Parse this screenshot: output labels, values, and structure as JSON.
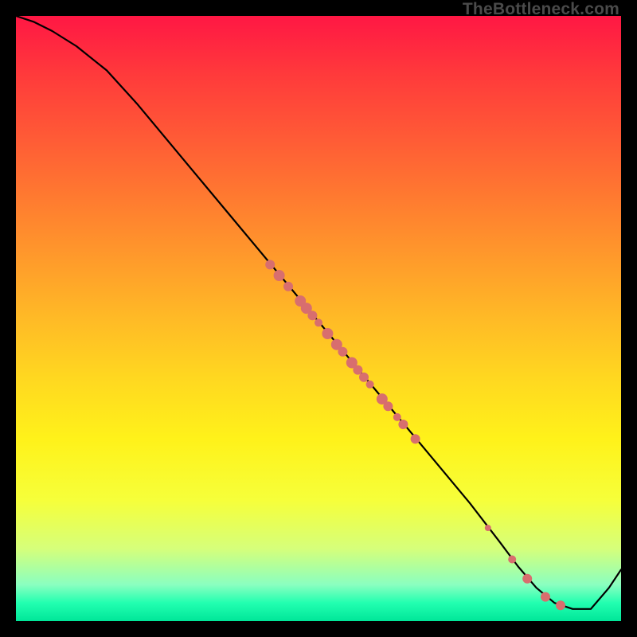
{
  "attribution": "TheBottleneck.com",
  "chart_data": {
    "type": "line",
    "title": "",
    "xlabel": "",
    "ylabel": "",
    "xlim": [
      0,
      100
    ],
    "ylim": [
      0,
      100
    ],
    "grid": false,
    "legend": false,
    "series": [
      {
        "name": "bottleneck-curve",
        "x": [
          0,
          3,
          6,
          10,
          15,
          20,
          25,
          30,
          35,
          40,
          45,
          50,
          55,
          60,
          65,
          70,
          75,
          80,
          83,
          86,
          89,
          92,
          95,
          98,
          100
        ],
        "y": [
          100,
          99,
          97.5,
          95,
          91,
          85.5,
          79.5,
          73.5,
          67.5,
          61.5,
          55.5,
          49.5,
          43.5,
          37.5,
          31.5,
          25.5,
          19.5,
          13,
          9,
          5.5,
          3,
          2,
          2,
          5.5,
          8.5
        ]
      }
    ],
    "highlight_points": {
      "name": "sample-dots",
      "color": "#d86e6e",
      "points": [
        {
          "x": 42,
          "y": 58.9,
          "r": 6
        },
        {
          "x": 43.5,
          "y": 57.1,
          "r": 7
        },
        {
          "x": 45,
          "y": 55.3,
          "r": 6
        },
        {
          "x": 47,
          "y": 52.9,
          "r": 7
        },
        {
          "x": 48,
          "y": 51.7,
          "r": 7
        },
        {
          "x": 49,
          "y": 50.5,
          "r": 6
        },
        {
          "x": 50,
          "y": 49.3,
          "r": 5
        },
        {
          "x": 51.5,
          "y": 47.5,
          "r": 7
        },
        {
          "x": 53,
          "y": 45.7,
          "r": 7
        },
        {
          "x": 54,
          "y": 44.5,
          "r": 6
        },
        {
          "x": 55.5,
          "y": 42.7,
          "r": 7
        },
        {
          "x": 56.5,
          "y": 41.5,
          "r": 6
        },
        {
          "x": 57.5,
          "y": 40.3,
          "r": 6
        },
        {
          "x": 58.5,
          "y": 39.1,
          "r": 5
        },
        {
          "x": 60.5,
          "y": 36.7,
          "r": 7
        },
        {
          "x": 61.5,
          "y": 35.5,
          "r": 6
        },
        {
          "x": 63,
          "y": 33.7,
          "r": 5
        },
        {
          "x": 64,
          "y": 32.5,
          "r": 6
        },
        {
          "x": 66,
          "y": 30.1,
          "r": 6
        },
        {
          "x": 78,
          "y": 15.4,
          "r": 4
        },
        {
          "x": 82,
          "y": 10.2,
          "r": 5
        },
        {
          "x": 84.5,
          "y": 7.0,
          "r": 6
        },
        {
          "x": 87.5,
          "y": 4.0,
          "r": 6
        },
        {
          "x": 90,
          "y": 2.6,
          "r": 6
        }
      ]
    }
  }
}
